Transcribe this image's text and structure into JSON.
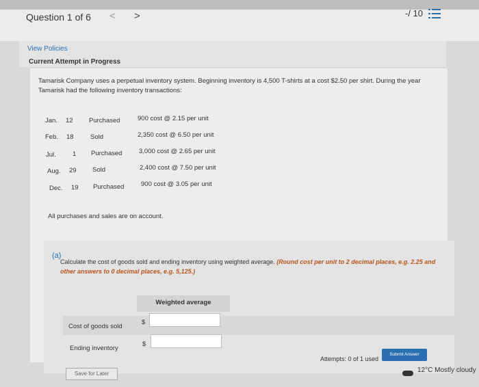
{
  "header": {
    "question_label": "Question 1 of 6",
    "prev_glyph": "<",
    "next_glyph": ">",
    "score": "-/ 10"
  },
  "top_panel": {
    "view_policies": "View Policies",
    "attempt_status": "Current Attempt in Progress"
  },
  "problem": {
    "text": "Tamarisk Company uses a perpetual inventory system. Beginning inventory is 4,500 T-shirts at a cost $2.50 per shirt. During the year Tamarisk had the following inventory transactions:",
    "transactions": [
      {
        "month": "Jan.",
        "day": "12",
        "type": "Purchased",
        "detail": "900 cost @ 2.15 per unit"
      },
      {
        "month": "Feb.",
        "day": "18",
        "type": "Sold",
        "detail": "2,350 cost @ 6.50 per unit"
      },
      {
        "month": "Jul.",
        "day": "1",
        "type": "Purchased",
        "detail": "3,000 cost @ 2.65 per unit"
      },
      {
        "month": "Aug.",
        "day": "29",
        "type": "Sold",
        "detail": "2,400 cost @ 7.50 per unit"
      },
      {
        "month": "Dec.",
        "day": "19",
        "type": "Purchased",
        "detail": "900 cost @ 3.05 per unit"
      }
    ],
    "note": "All purchases and sales are on account."
  },
  "part_a": {
    "label": "(a)",
    "instruction": "Calculate the cost of goods sold and ending inventory using weighted average.",
    "rounding": "(Round cost per unit to 2 decimal places, e.g. 2.25 and other answers to 0 decimal places, e.g. 5,125.)",
    "column_header": "Weighted average",
    "rows": [
      {
        "label": "Cost of goods sold",
        "currency": "$",
        "value": ""
      },
      {
        "label": "Ending inventory",
        "currency": "$",
        "value": ""
      }
    ]
  },
  "footer": {
    "attempts": "Attempts: 0 of 1 used",
    "submit": "Submit Answer",
    "save": "Save for Later"
  },
  "taskbar": {
    "weather": "12°C  Mostly cloudy"
  }
}
